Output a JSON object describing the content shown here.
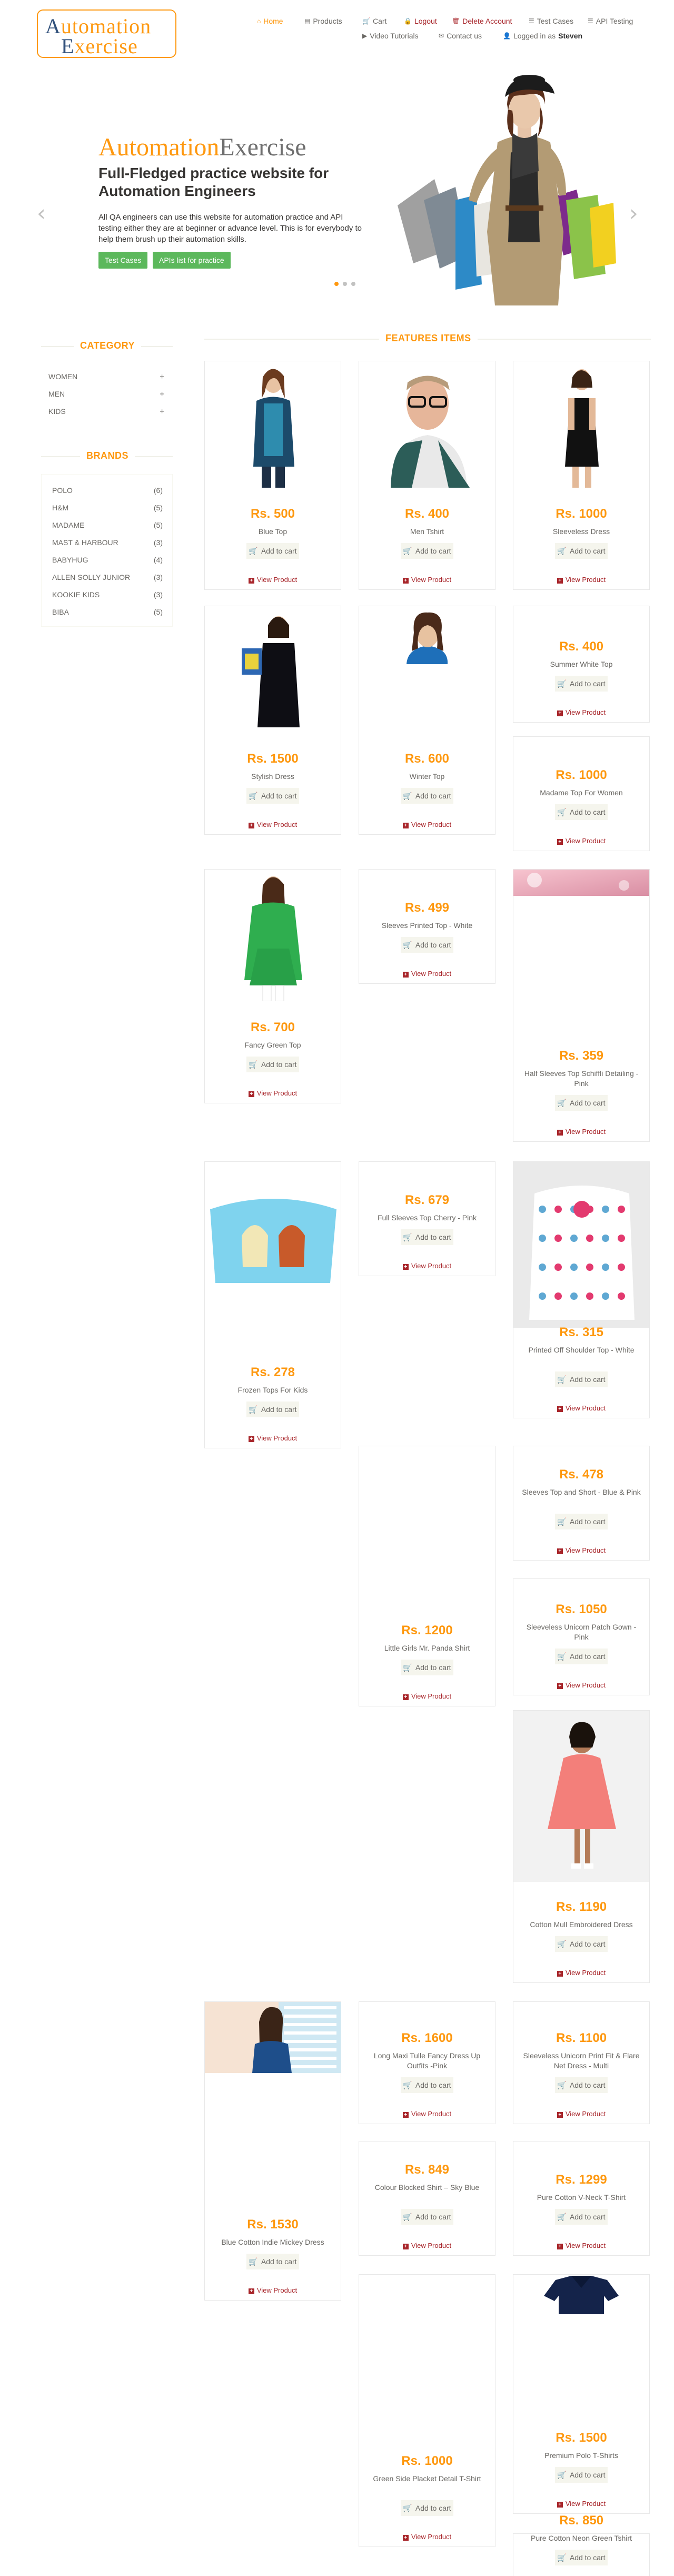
{
  "logo": {
    "line1_a": "A",
    "line1_b": "utomation",
    "line2_a": "E",
    "line2_b": "xercise"
  },
  "nav": {
    "home": "Home",
    "products": "Products",
    "cart": "Cart",
    "logout": "Logout",
    "delete_account": "Delete Account",
    "test_cases": "Test Cases",
    "api_testing": "API Testing",
    "video_tutorials": "Video Tutorials",
    "contact_us": "Contact us",
    "logged_in_as": "Logged in as",
    "username": "Steven"
  },
  "slider": {
    "brand_a": "Automation",
    "brand_b": "Exercise",
    "heading": "Full-Fledged practice website for Automation Engineers",
    "text": "All QA engineers can use this website for automation practice and API testing either they are at beginner or advance level. This is for everybody to help them brush up their automation skills.",
    "btn_test_cases": "Test Cases",
    "btn_apis": "APIs list for practice",
    "prev_icon": "‹",
    "next_icon": "›",
    "active_slide": 1,
    "slide_count": 3
  },
  "sidebar": {
    "category_title": "Category",
    "categories": [
      "Women",
      "Men",
      "Kids"
    ],
    "brands_title": "Brands",
    "brands": [
      {
        "name": "Polo",
        "count": "(6)"
      },
      {
        "name": "H&M",
        "count": "(5)"
      },
      {
        "name": "Madame",
        "count": "(5)"
      },
      {
        "name": "Mast & Harbour",
        "count": "(3)"
      },
      {
        "name": "Babyhug",
        "count": "(4)"
      },
      {
        "name": "Allen Solly Junior",
        "count": "(3)"
      },
      {
        "name": "Kookie Kids",
        "count": "(3)"
      },
      {
        "name": "Biba",
        "count": "(5)"
      }
    ]
  },
  "features_title": "Features Items",
  "add_to_cart": "Add to cart",
  "view_product": "View Product",
  "products": [
    {
      "price": "Rs. 500",
      "name": "Blue Top"
    },
    {
      "price": "Rs. 400",
      "name": "Men Tshirt"
    },
    {
      "price": "Rs. 1000",
      "name": "Sleeveless Dress"
    },
    {
      "price": "Rs. 1500",
      "name": "Stylish Dress"
    },
    {
      "price": "Rs. 600",
      "name": "Winter Top"
    },
    {
      "price": "Rs. 400",
      "name": "Summer White Top"
    },
    {
      "price": "Rs. 1000",
      "name": "Madame Top For Women"
    },
    {
      "price": "Rs. 700",
      "name": "Fancy Green Top"
    },
    {
      "price": "Rs. 499",
      "name": "Sleeves Printed Top - White"
    },
    {
      "price": "Rs. 359",
      "name": "Half Sleeves Top Schiffli Detailing - Pink"
    },
    {
      "price": "Rs. 278",
      "name": "Frozen Tops For Kids"
    },
    {
      "price": "Rs. 679",
      "name": "Full Sleeves Top Cherry - Pink"
    },
    {
      "price": "Rs. 315",
      "name": "Printed Off Shoulder Top - White"
    },
    {
      "price": "Rs. 1200",
      "name": "Little Girls Mr. Panda Shirt"
    },
    {
      "price": "Rs. 478",
      "name": "Sleeves Top and Short - Blue & Pink"
    },
    {
      "price": "Rs. 1050",
      "name": "Sleeveless Unicorn Patch Gown - Pink"
    },
    {
      "price": "Rs. 1190",
      "name": "Cotton Mull Embroidered Dress"
    },
    {
      "price": "Rs. 1530",
      "name": "Blue Cotton Indie Mickey Dress"
    },
    {
      "price": "Rs. 1600",
      "name": "Long Maxi Tulle Fancy Dress Up Outfits -Pink"
    },
    {
      "price": "Rs. 1100",
      "name": "Sleeveless Unicorn Print Fit & Flare Net Dress - Multi"
    },
    {
      "price": "Rs. 849",
      "name": "Colour Blocked Shirt – Sky Blue"
    },
    {
      "price": "Rs. 1299",
      "name": "Pure Cotton V-Neck T-Shirt"
    },
    {
      "price": "Rs. 1000",
      "name": "Green Side Placket Detail T-Shirt"
    },
    {
      "price": "Rs. 1500",
      "name": "Premium Polo T-Shirts"
    },
    {
      "price": "Rs. 850",
      "name": "Pure Cotton Neon Green Tshirt"
    }
  ],
  "colors": {
    "accent": "#FE980F",
    "link_red": "#a8262b",
    "button_green": "#5cb85c"
  }
}
